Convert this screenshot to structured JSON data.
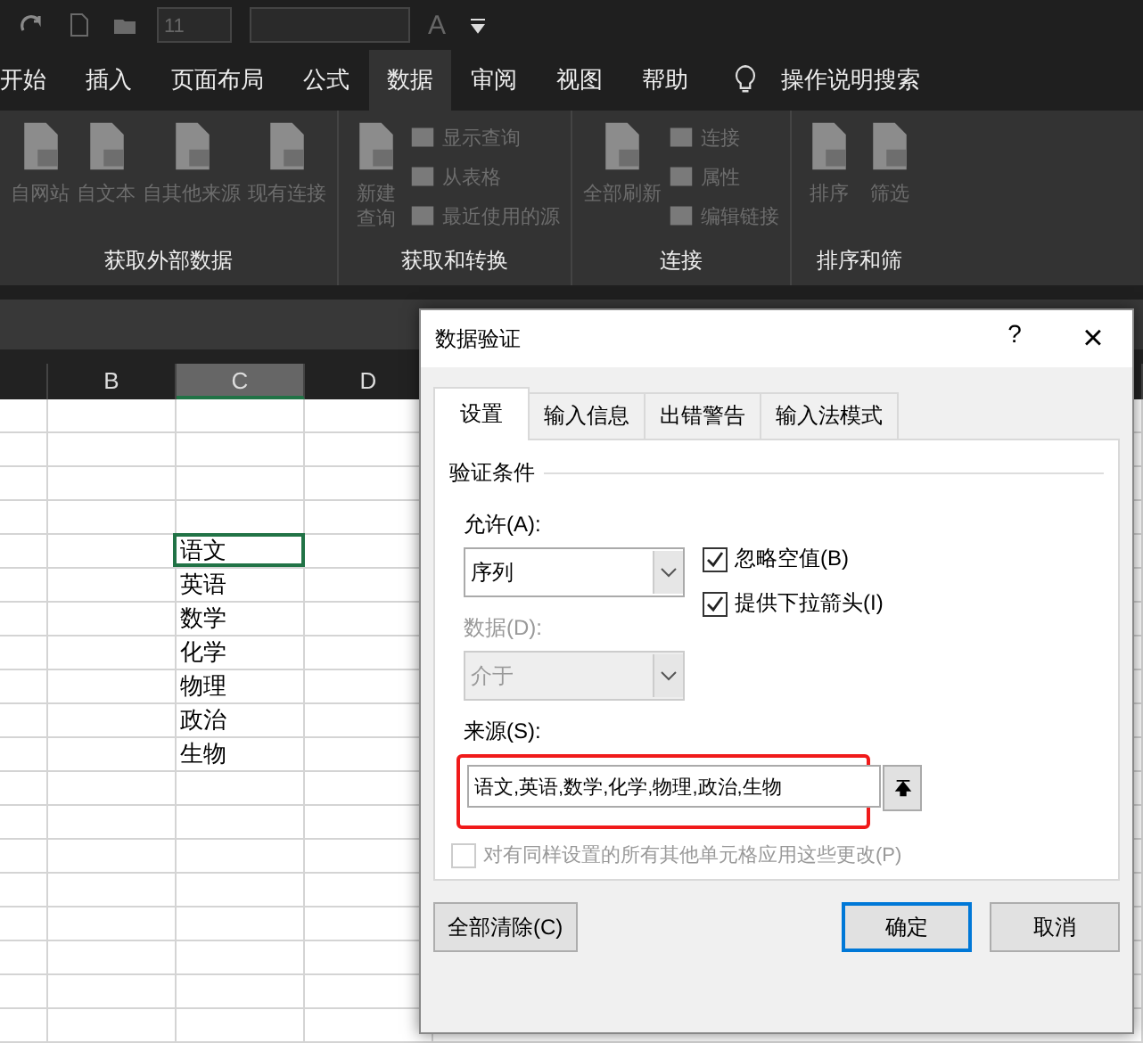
{
  "quick_access": {
    "font_size": "11",
    "font_letter": "A"
  },
  "ribbon_tabs": [
    {
      "label": "开始",
      "selected": false
    },
    {
      "label": "插入",
      "selected": false
    },
    {
      "label": "页面布局",
      "selected": false
    },
    {
      "label": "公式",
      "selected": false
    },
    {
      "label": "数据",
      "selected": true
    },
    {
      "label": "审阅",
      "selected": false
    },
    {
      "label": "视图",
      "selected": false
    },
    {
      "label": "帮助",
      "selected": false
    }
  ],
  "tell_me": "操作说明搜索",
  "ribbon_groups": [
    {
      "label": "获取外部数据",
      "commands": [
        {
          "label": "自网站",
          "kind": "large"
        },
        {
          "label": "自文本",
          "kind": "large"
        },
        {
          "label": "自其他来源",
          "kind": "large"
        },
        {
          "label": "现有连接",
          "kind": "large"
        }
      ]
    },
    {
      "label": "获取和转换",
      "commands": [
        {
          "label": "新建查询",
          "kind": "large"
        },
        {
          "label": "显示查询",
          "kind": "small"
        },
        {
          "label": "从表格",
          "kind": "small"
        },
        {
          "label": "最近使用的源",
          "kind": "small"
        }
      ]
    },
    {
      "label": "连接",
      "commands": [
        {
          "label": "全部刷新",
          "kind": "large"
        },
        {
          "label": "连接",
          "kind": "small"
        },
        {
          "label": "属性",
          "kind": "small"
        },
        {
          "label": "编辑链接",
          "kind": "small"
        }
      ]
    },
    {
      "label": "排序和筛",
      "commands": [
        {
          "label": "排序",
          "kind": "large"
        },
        {
          "label": "筛选",
          "kind": "large"
        }
      ]
    }
  ],
  "columns": [
    {
      "label": "B",
      "selected": false
    },
    {
      "label": "C",
      "selected": true
    },
    {
      "label": "D",
      "selected": false
    }
  ],
  "c_cells": [
    {
      "text": "语文",
      "selected": true
    },
    {
      "text": "英语",
      "selected": false
    },
    {
      "text": "数学",
      "selected": false
    },
    {
      "text": "化学",
      "selected": false
    },
    {
      "text": "物理",
      "selected": false
    },
    {
      "text": "政治",
      "selected": false
    },
    {
      "text": "生物",
      "selected": false
    }
  ],
  "dialog": {
    "title": "数据验证",
    "help": "?",
    "close": "×",
    "tabs": [
      {
        "label": "设置",
        "selected": true
      },
      {
        "label": "输入信息",
        "selected": false
      },
      {
        "label": "出错警告",
        "selected": false
      },
      {
        "label": "输入法模式",
        "selected": false
      }
    ],
    "group_title": "验证条件",
    "allow": {
      "label": "允许(A):",
      "value": "序列",
      "disabled": false
    },
    "data": {
      "label": "数据(D):",
      "value": "介于",
      "disabled": true
    },
    "checkboxes": [
      {
        "label": "忽略空值(B)",
        "checked": true
      },
      {
        "label": "提供下拉箭头(I)",
        "checked": true
      }
    ],
    "source": {
      "label": "来源(S):",
      "value": "语文,英语,数学,化学,物理,政治,生物",
      "highlighted": true
    },
    "apply_all": {
      "label": "对有同样设置的所有其他单元格应用这些更改(P)",
      "checked": false,
      "disabled": true
    },
    "buttons": [
      {
        "label": "全部清除(C)",
        "kind": "left"
      },
      {
        "label": "确定",
        "kind": "default"
      },
      {
        "label": "取消",
        "kind": "normal"
      }
    ]
  }
}
